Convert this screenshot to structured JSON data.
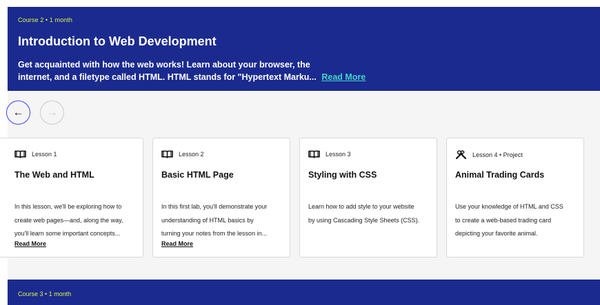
{
  "course2": {
    "meta": "Course 2 • 1 month",
    "title": "Introduction to Web Development",
    "description_line1": "Get acquainted with how the web works! Learn about your browser, the",
    "description_line2": "internet, and a filetype called HTML. HTML stands for \"Hypertext Marku...",
    "read_more": "Read More"
  },
  "nav": {
    "prev_icon": "arrow-left-icon",
    "prev_glyph": "←",
    "next_icon": "arrow-right-icon",
    "next_glyph": "→"
  },
  "lessons": [
    {
      "icon": "book-icon",
      "label": "Lesson 1",
      "title": "The Web and HTML",
      "desc_line1": "In this lesson, we'll be exploring how to",
      "desc_line2": "create web pages—and, along the way,",
      "desc_line3": "you'll learn some important concepts...",
      "read_more": "Read More"
    },
    {
      "icon": "book-icon",
      "label": "Lesson 2",
      "title": "Basic HTML Page",
      "desc_line1": "In this first lab, you'll demonstrate your",
      "desc_line2": "understanding of HTML basics by",
      "desc_line3": "turning your notes from the lesson in...",
      "read_more": "Read More"
    },
    {
      "icon": "book-icon",
      "label": "Lesson 3",
      "title": "Styling with CSS",
      "desc_line1": "Learn how to add style to your website",
      "desc_line2": "by using Cascading Style Sheets (CSS).",
      "desc_line3": ""
    },
    {
      "icon": "tools-icon",
      "label": "Lesson 4 • Project",
      "title": "Animal Trading Cards",
      "desc_line1": "Use your knowledge of HTML and CSS",
      "desc_line2": "to create a web-based trading card",
      "desc_line3": "depicting your favorite animal."
    }
  ],
  "course3": {
    "meta": "Course 3 • 1 month"
  },
  "colors": {
    "banner": "#1b2a8f",
    "meta_accent": "#d7f542",
    "read_more_accent": "#3fd6c6",
    "nav_active_border": "#3a3ff0"
  }
}
